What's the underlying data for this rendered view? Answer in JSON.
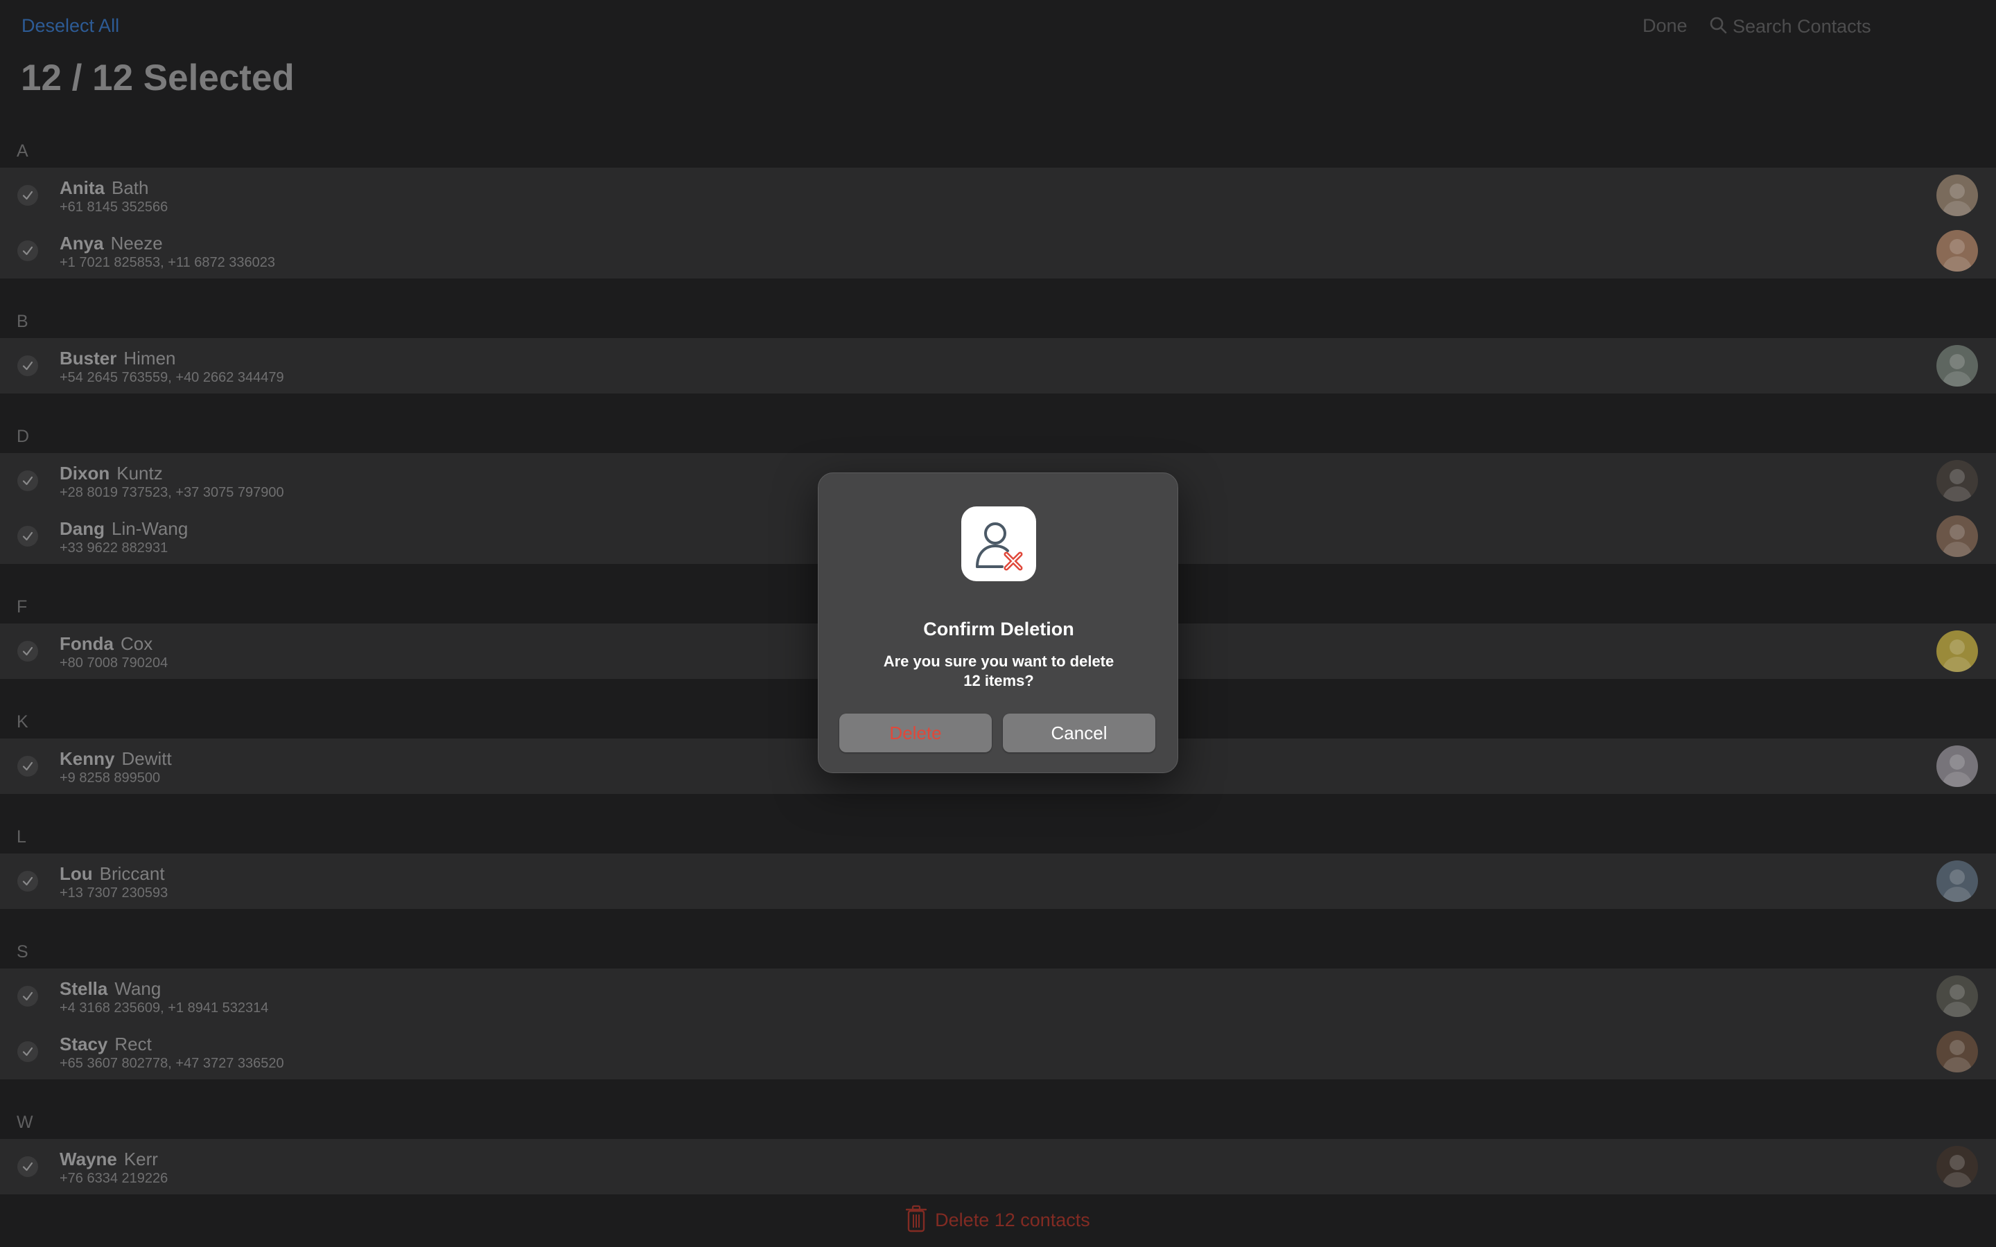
{
  "toolbar": {
    "deselect_all_label": "Deselect All",
    "done_label": "Done",
    "search_placeholder": "Search Contacts",
    "search_icon": "magnifying-glass-icon"
  },
  "page_title": "12 / 12 Selected",
  "sections": [
    {
      "letter": "A",
      "contacts": [
        {
          "first": "Anita",
          "last": "Bath",
          "phones": "+61 8145 352566",
          "avatar_color": "#7a6b5c"
        },
        {
          "first": "Anya",
          "last": "Neeze",
          "phones": "+1 7021 825853, +11 6872 336023",
          "avatar_color": "#8a6a55"
        }
      ]
    },
    {
      "letter": "B",
      "contacts": [
        {
          "first": "Buster",
          "last": "Himen",
          "phones": "+54 2645 763559, +40 2662 344479",
          "avatar_color": "#5e6660"
        }
      ]
    },
    {
      "letter": "D",
      "contacts": [
        {
          "first": "Dixon",
          "last": "Kuntz",
          "phones": "+28 8019 737523, +37 3075 797900",
          "avatar_color": "#3f3a36"
        },
        {
          "first": "Dang",
          "last": "Lin-Wang",
          "phones": "+33 9622 882931",
          "avatar_color": "#6b5648"
        }
      ]
    },
    {
      "letter": "F",
      "contacts": [
        {
          "first": "Fonda",
          "last": "Cox",
          "phones": "+80 7008 790204",
          "avatar_color": "#9a8a3a"
        }
      ]
    },
    {
      "letter": "K",
      "contacts": [
        {
          "first": "Kenny",
          "last": "Dewitt",
          "phones": "+9 8258 899500",
          "avatar_color": "#77747a"
        }
      ]
    },
    {
      "letter": "L",
      "contacts": [
        {
          "first": "Lou",
          "last": "Briccant",
          "phones": "+13 7307 230593",
          "avatar_color": "#4e5a66"
        }
      ]
    },
    {
      "letter": "S",
      "contacts": [
        {
          "first": "Stella",
          "last": "Wang",
          "phones": "+4 3168 235609, +1 8941 532314",
          "avatar_color": "#4a4a44"
        },
        {
          "first": "Stacy",
          "last": "Rect",
          "phones": "+65 3607 802778, +47 3727 336520",
          "avatar_color": "#5a4638"
        }
      ]
    },
    {
      "letter": "W",
      "contacts": [
        {
          "first": "Wayne",
          "last": "Kerr",
          "phones": "+76 6334 219226",
          "avatar_color": "#3a302a"
        }
      ]
    }
  ],
  "bottom_bar": {
    "delete_label": "Delete 12 contacts",
    "icon": "trash-icon"
  },
  "dialog": {
    "icon": "remove-contact-icon",
    "title": "Confirm Deletion",
    "message": "Are you sure you want to delete 12 items?",
    "delete_button": "Delete",
    "cancel_button": "Cancel"
  },
  "colors": {
    "background": "#1c1c1d",
    "row_background": "#2a2a2b",
    "accent_blue": "#2d5b95",
    "destructive_red": "#e0483a",
    "dialog_background": "#464647"
  }
}
